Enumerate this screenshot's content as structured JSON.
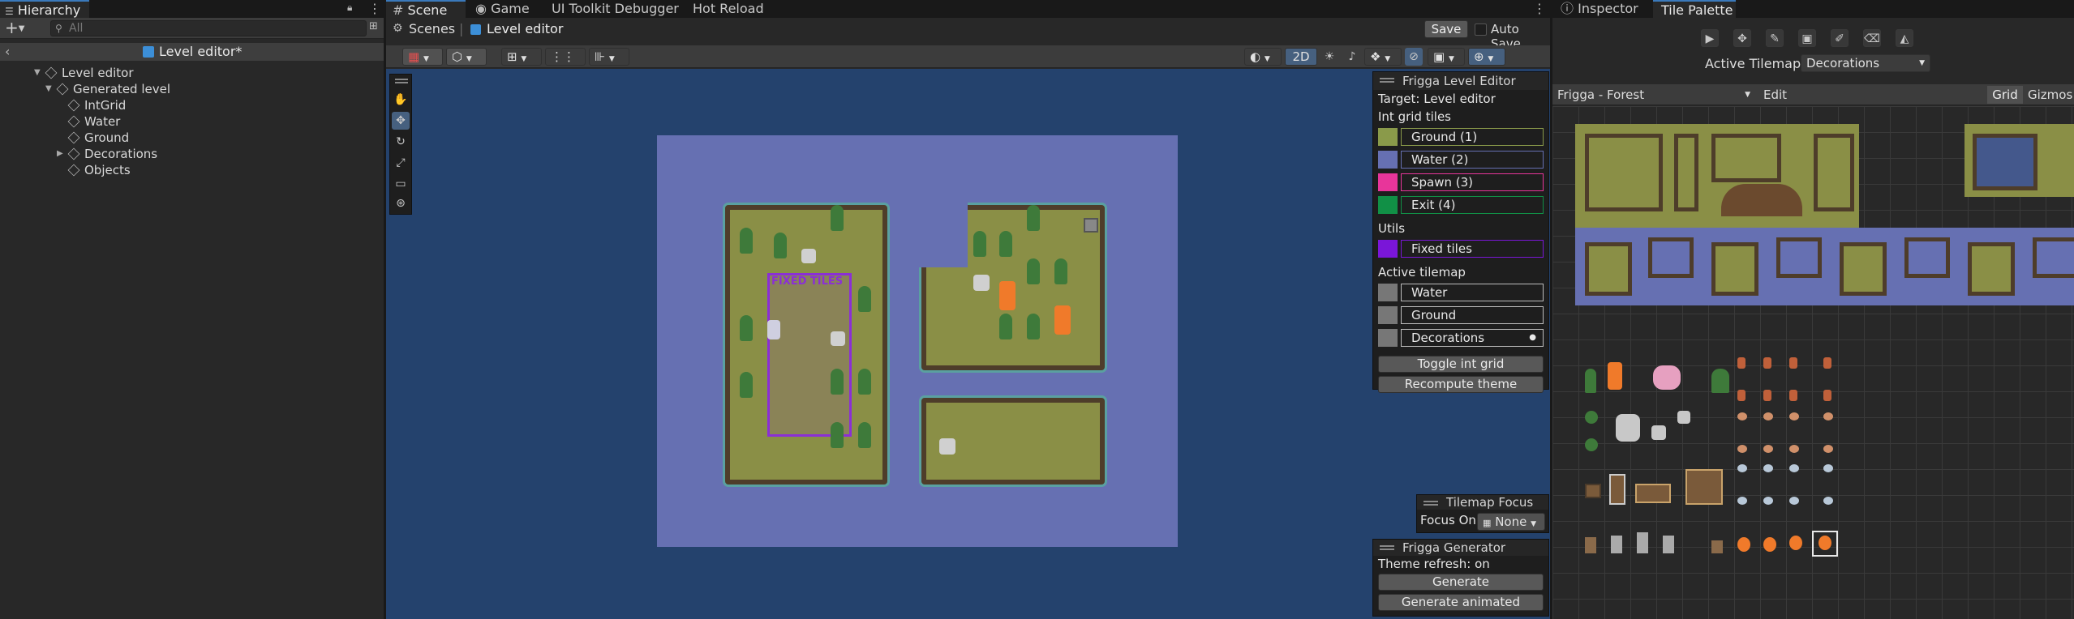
{
  "hierarchy": {
    "tab_title": "Hierarchy",
    "search_placeholder": "All",
    "add_label": "+",
    "scene_name": "Level editor*",
    "items": [
      {
        "label": "Level editor"
      },
      {
        "label": "Generated level"
      },
      {
        "label": "IntGrid"
      },
      {
        "label": "Water"
      },
      {
        "label": "Ground"
      },
      {
        "label": "Decorations"
      },
      {
        "label": "Objects"
      }
    ]
  },
  "center_tabs": {
    "scene": "Scene",
    "game": "Game",
    "uitk": "UI Toolkit Debugger",
    "hot_reload": "Hot Reload"
  },
  "breadcrumb": {
    "scenes": "Scenes",
    "current": "Level editor",
    "save": "Save",
    "auto_save": "Auto Save"
  },
  "scene_toolbar": {
    "two_d": "2D"
  },
  "level_editor_overlay": {
    "title": "Frigga Level Editor",
    "target": "Target: Level editor",
    "int_grid_heading": "Int grid tiles",
    "int_grid_tiles": [
      {
        "label": "Ground (1)",
        "color": "#8a9a4a"
      },
      {
        "label": "Water (2)",
        "color": "#6670b2"
      },
      {
        "label": "Spawn (3)",
        "color": "#e8359a"
      },
      {
        "label": "Exit (4)",
        "color": "#119046"
      }
    ],
    "utils_heading": "Utils",
    "utils": [
      {
        "label": "Fixed tiles",
        "color": "#7a16d8"
      }
    ],
    "active_tilemap_heading": "Active tilemap",
    "tilemaps": [
      {
        "label": "Water"
      },
      {
        "label": "Ground"
      },
      {
        "label": "Decorations",
        "marker": "●"
      }
    ],
    "toggle_button": "Toggle int grid",
    "recompute_button": "Recompute theme"
  },
  "tilemap_focus": {
    "title": "Tilemap Focus",
    "focus_on": "Focus On",
    "value": "None"
  },
  "generator": {
    "title": "Frigga Generator",
    "theme_refresh": "Theme refresh: on",
    "generate": "Generate",
    "generate_animated": "Generate animated"
  },
  "scene_view": {
    "fixed_tiles_label": "FIXED TILES"
  },
  "right_tabs": {
    "inspector": "Inspector",
    "tile_palette": "Tile Palette"
  },
  "palette": {
    "active_tilemap_label": "Active Tilemap",
    "active_tilemap_value": "Decorations",
    "palette_name": "Frigga - Forest",
    "edit": "Edit",
    "grid": "Grid",
    "gizmos": "Gizmos"
  },
  "colors": {
    "accent": "#3a79bb",
    "water": "#44588c",
    "ground": "#8a8f46",
    "fixed_tiles": "#8b2fd6"
  }
}
